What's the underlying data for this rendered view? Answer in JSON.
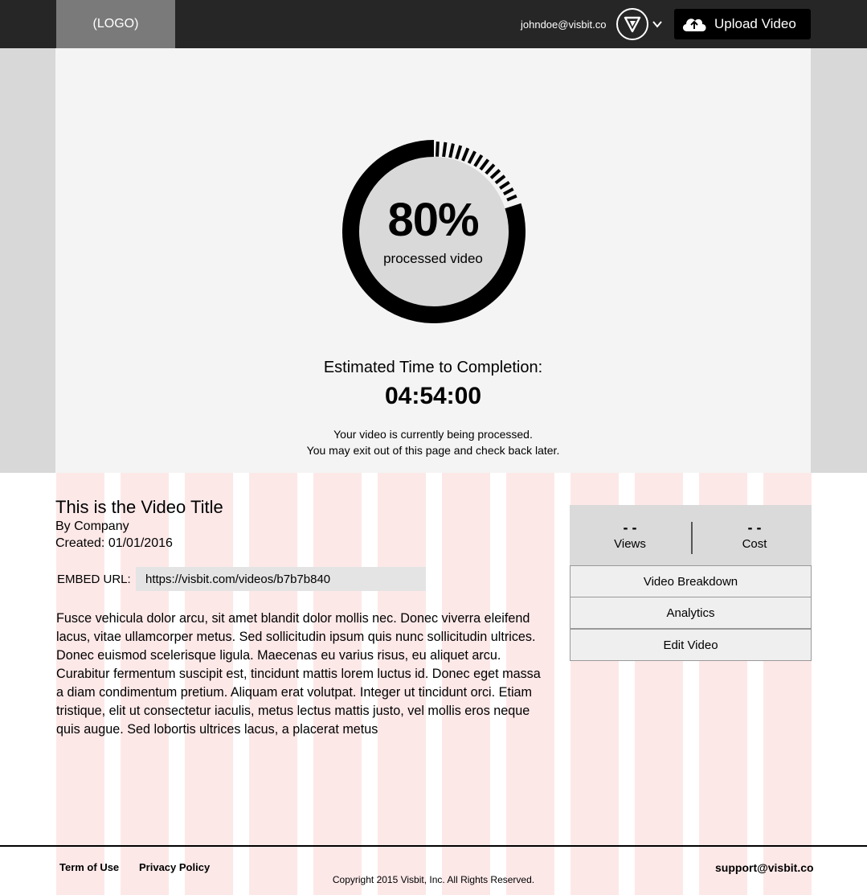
{
  "header": {
    "logo_text": "(LOGO)",
    "user_email": "johndoe@visbit.co",
    "avatar_icon": "visbit-v-logo-icon",
    "menu_icon": "chevron-down-icon",
    "upload_icon": "cloud-upload-icon",
    "upload_label": "Upload Video"
  },
  "processing": {
    "progress": 0.8,
    "percent_text": "80%",
    "percent_caption": "processed video",
    "eta_label": "Estimated Time to Completion:",
    "eta_value": "04:54:00",
    "notice_line1": "Your video is currently being processed.",
    "notice_line2": "You may exit out of this page and check back later."
  },
  "video": {
    "title": "This is the Video Title",
    "by": "By Company",
    "created": "Created: 01/01/2016",
    "embed_label": "EMBED URL:",
    "embed_url": "https://visbit.com/videos/b7b7b840",
    "description": "Fusce vehicula dolor arcu, sit amet blandit dolor mollis nec. Donec viverra eleifend lacus, vitae ullamcorper metus. Sed sollicitudin ipsum quis nunc sollicitudin ultrices. Donec euismod scelerisque ligula. Maecenas eu varius risus, eu aliquet arcu. Curabitur fermentum suscipit est, tincidunt mattis lorem luctus id. Donec eget massa a diam condimentum pretium. Aliquam erat volutpat. Integer ut tincidunt orci. Etiam tristique, elit ut consectetur iaculis, metus lectus mattis justo, vel mollis eros neque quis augue. Sed lobortis ultrices lacus, a placerat metus"
  },
  "stats": {
    "views_value": "- -",
    "views_label": "Views",
    "cost_value": "- -",
    "cost_label": "Cost"
  },
  "actions": {
    "breakdown": "Video Breakdown",
    "analytics": "Analytics",
    "edit": "Edit Video"
  },
  "footer": {
    "terms": "Term of Use",
    "privacy": "Privacy Policy",
    "copyright": "Copyright 2015 Visbit, Inc. All Rights Reserved.",
    "support": "support@visbit.co"
  },
  "colors": {
    "topbar": "#262626",
    "logo_bg": "#7a7a7a",
    "grid_stripe": "#fde8e8",
    "panel_bg": "#f4f4f4"
  }
}
